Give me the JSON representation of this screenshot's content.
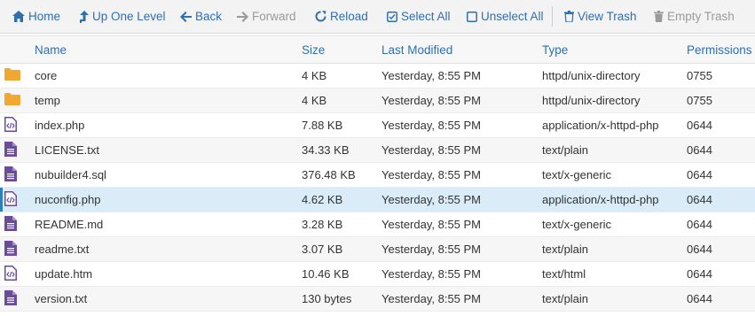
{
  "toolbar": {
    "home": "Home",
    "up": "Up One Level",
    "back": "Back",
    "forward": "Forward",
    "reload": "Reload",
    "select_all": "Select All",
    "unselect_all": "Unselect All",
    "view_trash": "View Trash",
    "empty_trash": "Empty Trash"
  },
  "columns": {
    "name": "Name",
    "size": "Size",
    "modified": "Last Modified",
    "type": "Type",
    "permissions": "Permissions"
  },
  "files": [
    {
      "name": "core",
      "size": "4 KB",
      "modified": "Yesterday, 8:55 PM",
      "type": "httpd/unix-directory",
      "perm": "0755",
      "icon": "folder-icon"
    },
    {
      "name": "temp",
      "size": "4 KB",
      "modified": "Yesterday, 8:55 PM",
      "type": "httpd/unix-directory",
      "perm": "0755",
      "icon": "folder-icon"
    },
    {
      "name": "index.php",
      "size": "7.88 KB",
      "modified": "Yesterday, 8:55 PM",
      "type": "application/x-httpd-php",
      "perm": "0644",
      "icon": "code-file-icon"
    },
    {
      "name": "LICENSE.txt",
      "size": "34.33 KB",
      "modified": "Yesterday, 8:55 PM",
      "type": "text/plain",
      "perm": "0644",
      "icon": "text-file-icon"
    },
    {
      "name": "nubuilder4.sql",
      "size": "376.48 KB",
      "modified": "Yesterday, 8:55 PM",
      "type": "text/x-generic",
      "perm": "0644",
      "icon": "text-file-icon"
    },
    {
      "name": "nuconfig.php",
      "size": "4.62 KB",
      "modified": "Yesterday, 8:55 PM",
      "type": "application/x-httpd-php",
      "perm": "0644",
      "icon": "code-file-icon"
    },
    {
      "name": "README.md",
      "size": "3.28 KB",
      "modified": "Yesterday, 8:55 PM",
      "type": "text/x-generic",
      "perm": "0644",
      "icon": "text-file-icon"
    },
    {
      "name": "readme.txt",
      "size": "3.07 KB",
      "modified": "Yesterday, 8:55 PM",
      "type": "text/plain",
      "perm": "0644",
      "icon": "text-file-icon"
    },
    {
      "name": "update.htm",
      "size": "10.46 KB",
      "modified": "Yesterday, 8:55 PM",
      "type": "text/html",
      "perm": "0644",
      "icon": "code-file-icon"
    },
    {
      "name": "version.txt",
      "size": "130 bytes",
      "modified": "Yesterday, 8:55 PM",
      "type": "text/plain",
      "perm": "0644",
      "icon": "text-file-icon"
    }
  ],
  "selected_row": "nuconfig.php",
  "colors": {
    "link": "#2f6fae",
    "folder": "#f0a830",
    "file": "#6b4c9a",
    "selected": "#d9ecf8"
  }
}
